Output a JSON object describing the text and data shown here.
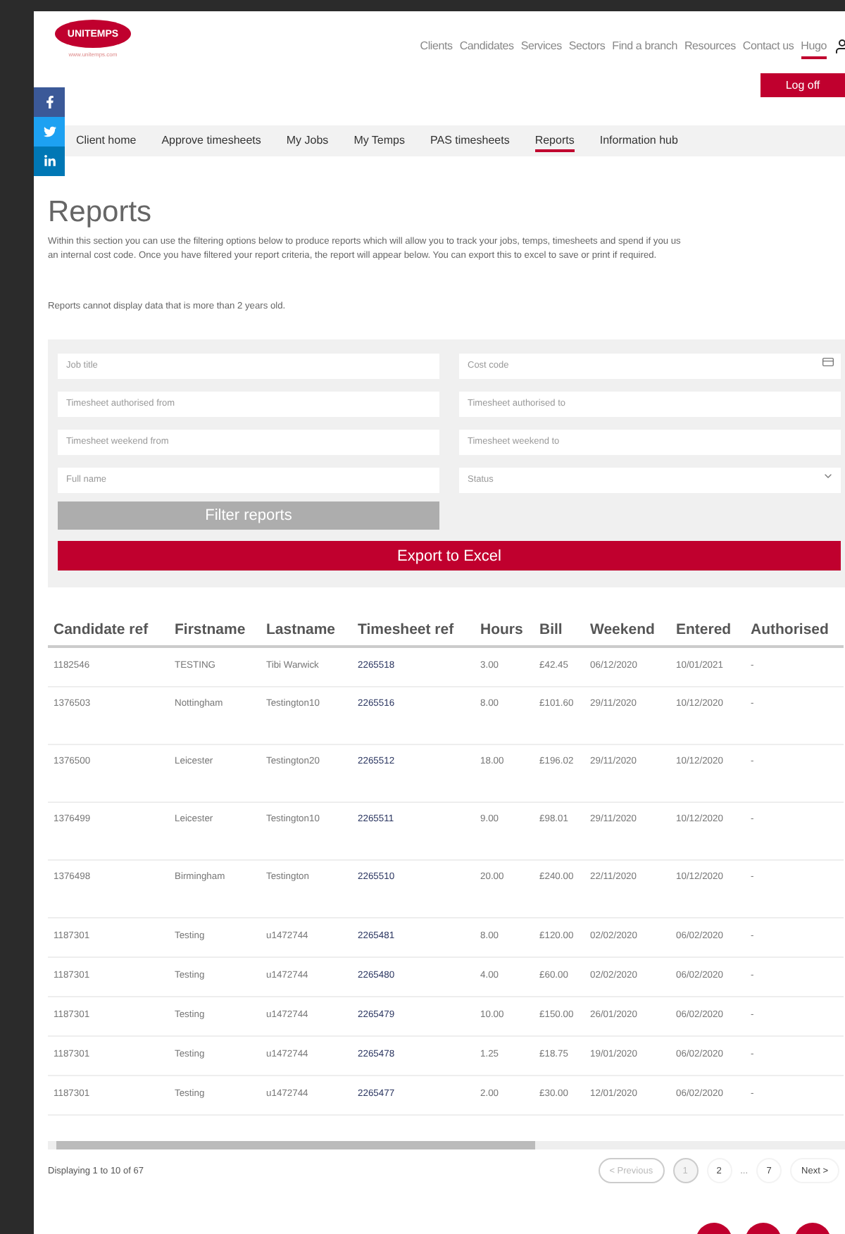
{
  "header": {
    "logo": "UNITEMPS",
    "logo_url": "www.unitemps.com",
    "nav": [
      {
        "label": "Clients",
        "selected": false
      },
      {
        "label": "Candidates",
        "selected": false
      },
      {
        "label": "Services",
        "selected": false
      },
      {
        "label": "Sectors",
        "selected": false
      },
      {
        "label": "Find a branch",
        "selected": false
      },
      {
        "label": "Resources",
        "selected": false
      },
      {
        "label": "Contact us",
        "selected": false
      },
      {
        "label": "Hugo",
        "selected": true
      }
    ],
    "logoff": "Log off"
  },
  "tabs": [
    {
      "label": "Client home",
      "selected": false
    },
    {
      "label": "Approve timesheets",
      "selected": false
    },
    {
      "label": "My Jobs",
      "selected": false
    },
    {
      "label": "My Temps",
      "selected": false
    },
    {
      "label": "PAS timesheets",
      "selected": false
    },
    {
      "label": "Reports",
      "selected": true
    },
    {
      "label": "Information hub",
      "selected": false
    }
  ],
  "title": "Reports",
  "intro_lines": [
    "Within this section you can use the filtering options below to produce reports which will allow you to track your jobs, temps, timesheets and spend if you us",
    "an internal cost code. Once you have filtered your report criteria, the report will appear below. You can export this to excel to save or print if required."
  ],
  "note": "Reports cannot display data that is more than 2 years old.",
  "filters": [
    {
      "placeholder": "Job title",
      "kind": "text"
    },
    {
      "placeholder": "Cost code",
      "kind": "code"
    },
    {
      "placeholder": "Timesheet authorised from",
      "kind": "text"
    },
    {
      "placeholder": "Timesheet authorised to",
      "kind": "text"
    },
    {
      "placeholder": "Timesheet weekend from",
      "kind": "text"
    },
    {
      "placeholder": "Timesheet weekend to",
      "kind": "text"
    },
    {
      "placeholder": "Full name",
      "kind": "text"
    },
    {
      "placeholder": "Status",
      "kind": "select"
    }
  ],
  "filter_button": {
    "label": "Filter reports",
    "disabled": true
  },
  "export_button": "Export to Excel",
  "table": {
    "columns": [
      "Candidate ref",
      "Firstname",
      "Lastname",
      "Timesheet ref",
      "Hours",
      "Bill",
      "Weekend",
      "Entered",
      "Authorised"
    ],
    "rows": [
      [
        "1182546",
        "TESTING",
        "Tibi Warwick",
        "2265518",
        "3.00",
        "£42.45",
        "06/12/2020",
        "10/01/2021",
        "-"
      ],
      [
        "1376503",
        "Nottingham",
        "Testington10",
        "2265516",
        "8.00",
        "£101.60",
        "29/11/2020",
        "10/12/2020",
        "-"
      ],
      [
        "1376500",
        "Leicester",
        "Testington20",
        "2265512",
        "18.00",
        "£196.02",
        "29/11/2020",
        "10/12/2020",
        "-"
      ],
      [
        "1376499",
        "Leicester",
        "Testington10",
        "2265511",
        "9.00",
        "£98.01",
        "29/11/2020",
        "10/12/2020",
        "-"
      ],
      [
        "1376498",
        "Birmingham",
        "Testington",
        "2265510",
        "20.00",
        "£240.00",
        "22/11/2020",
        "10/12/2020",
        "-"
      ],
      [
        "1187301",
        "Testing",
        "u1472744",
        "2265481",
        "8.00",
        "£120.00",
        "02/02/2020",
        "06/02/2020",
        "-"
      ],
      [
        "1187301",
        "Testing",
        "u1472744",
        "2265480",
        "4.00",
        "£60.00",
        "02/02/2020",
        "06/02/2020",
        "-"
      ],
      [
        "1187301",
        "Testing",
        "u1472744",
        "2265479",
        "10.00",
        "£150.00",
        "26/01/2020",
        "06/02/2020",
        "-"
      ],
      [
        "1187301",
        "Testing",
        "u1472744",
        "2265478",
        "1.25",
        "£18.75",
        "19/01/2020",
        "06/02/2020",
        "-"
      ],
      [
        "1187301",
        "Testing",
        "u1472744",
        "2265477",
        "2.00",
        "£30.00",
        "12/01/2020",
        "06/02/2020",
        "-"
      ]
    ]
  },
  "summary": "Displaying 1 to 10 of 67",
  "pagination": {
    "previous": {
      "label": "< Previous",
      "disabled": true
    },
    "pages": [
      {
        "label": "1",
        "selected": true
      },
      {
        "label": "2",
        "selected": false
      }
    ],
    "gap": "...",
    "last_page": "7",
    "next": "Next >"
  }
}
